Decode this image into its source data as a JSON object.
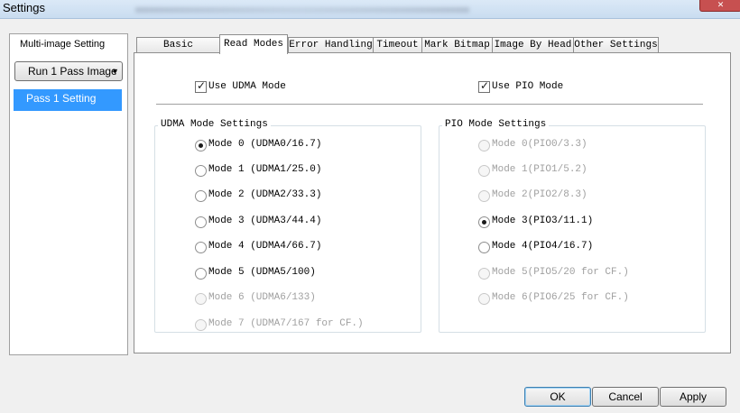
{
  "window": {
    "title": "Settings"
  },
  "left_panel": {
    "title": "Multi-image Setting",
    "dropdown_label": "Run 1 Pass Image",
    "items": [
      {
        "label": "Pass 1 Setting",
        "selected": true
      }
    ]
  },
  "tabs": [
    {
      "label": "Basic Settings",
      "active": false
    },
    {
      "label": "Read Modes",
      "active": true
    },
    {
      "label": "Error Handling",
      "active": false
    },
    {
      "label": "Timeout",
      "active": false
    },
    {
      "label": "Mark Bitmap",
      "active": false
    },
    {
      "label": "Image By Head",
      "active": false
    },
    {
      "label": "Other Settings",
      "active": false
    }
  ],
  "read_modes": {
    "use_udma": {
      "label": "Use UDMA Mode",
      "checked": true
    },
    "use_pio": {
      "label": "Use PIO Mode",
      "checked": true
    },
    "udma_group": {
      "title": "UDMA Mode Settings",
      "options": [
        {
          "label": "Mode 0 (UDMA0/16.7)",
          "checked": true,
          "enabled": true
        },
        {
          "label": "Mode 1 (UDMA1/25.0)",
          "checked": false,
          "enabled": true
        },
        {
          "label": "Mode 2 (UDMA2/33.3)",
          "checked": false,
          "enabled": true
        },
        {
          "label": "Mode 3 (UDMA3/44.4)",
          "checked": false,
          "enabled": true
        },
        {
          "label": "Mode 4 (UDMA4/66.7)",
          "checked": false,
          "enabled": true
        },
        {
          "label": "Mode 5 (UDMA5/100)",
          "checked": false,
          "enabled": true
        },
        {
          "label": "Mode 6 (UDMA6/133)",
          "checked": false,
          "enabled": false
        },
        {
          "label": "Mode 7 (UDMA7/167 for CF.)",
          "checked": false,
          "enabled": false
        }
      ]
    },
    "pio_group": {
      "title": "PIO Mode Settings",
      "options": [
        {
          "label": "Mode 0(PIO0/3.3)",
          "checked": false,
          "enabled": false
        },
        {
          "label": "Mode 1(PIO1/5.2)",
          "checked": false,
          "enabled": false
        },
        {
          "label": "Mode 2(PIO2/8.3)",
          "checked": false,
          "enabled": false
        },
        {
          "label": "Mode 3(PIO3/11.1)",
          "checked": true,
          "enabled": true
        },
        {
          "label": "Mode 4(PIO4/16.7)",
          "checked": false,
          "enabled": true
        },
        {
          "label": "Mode 5(PIO5/20 for CF.)",
          "checked": false,
          "enabled": false
        },
        {
          "label": "Mode 6(PIO6/25 for CF.)",
          "checked": false,
          "enabled": false
        }
      ]
    }
  },
  "buttons": {
    "ok": "OK",
    "cancel": "Cancel",
    "apply": "Apply"
  },
  "icons": {
    "close": "close-icon",
    "dropdown": "chevron-down-icon",
    "check": "checkmark-icon"
  },
  "colors": {
    "selection": "#3399ff",
    "titlebar": "#c9dcf0",
    "close": "#c75050"
  }
}
